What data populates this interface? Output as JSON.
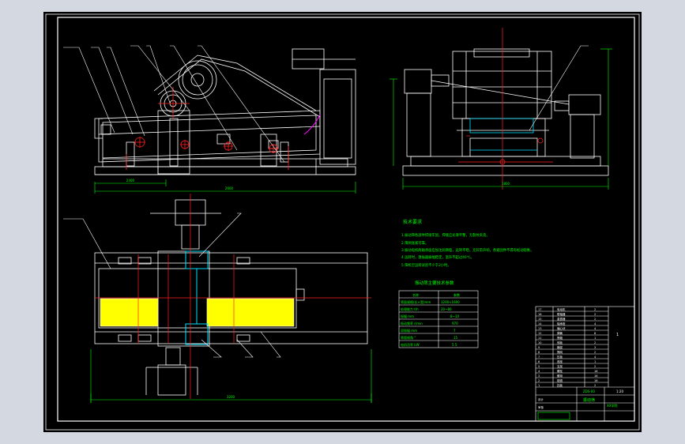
{
  "app": {
    "title": "CAD drawing viewer"
  },
  "colors": {
    "viewport_bg": "#d4d8e0",
    "sheet": "#000000",
    "border": "#ffffff",
    "geometry": "#ffffff",
    "center_line": "#ff2020",
    "dimension": "#00ff00",
    "notes_text": "#00ff00",
    "highlight": "#00e0ff",
    "screen_fill": "#ffff00",
    "spring": "#ff00ff",
    "leader": "#ffffff"
  },
  "icons": {
    "title_block_logo": "company-logo-icon"
  },
  "views": {
    "front": {
      "overall_dimension": "2600",
      "base_dimension": "2400"
    },
    "side": {
      "width_dimension": "1800"
    },
    "top": {
      "length_dimension": "3200",
      "width_dimension": "1600"
    }
  },
  "notes": {
    "title": "技术要求",
    "items": [
      "1.振动筛各部件焊接牢固，焊缝应光滑平整，无裂纹夹渣。",
      "2.筛网张紧可靠。",
      "3.振动电机两轴承座应加注润滑脂，运转平稳，无异常声响，各紧固件不得有松动现象。",
      "4.运转时，激振器振幅稳定，温升不超过40℃。",
      "5.筛机空运转试验不少于2小时。"
    ]
  },
  "params_table": {
    "title": "振动筛主要技术参数",
    "headers": [
      "名称",
      "参数"
    ],
    "rows": [
      [
        "筛面规格(长×宽)mm",
        "3200×1600"
      ],
      [
        "处理能力 t/h",
        "20~80"
      ],
      [
        "振幅 mm",
        "8~10"
      ],
      [
        "振动频率 r/min",
        "970"
      ],
      [
        "双振幅 mm",
        "7"
      ],
      [
        "筛面倾角 °",
        "15"
      ],
      [
        "电机功率 kW",
        "5.5"
      ]
    ]
  },
  "title_block": {
    "drawing_name": "振动筛",
    "drawing_no": "ZDS-00",
    "scale": "1:20",
    "sheet": "1",
    "label_design": "设计",
    "label_check": "审核",
    "school": "XX学院",
    "part_rows": [
      [
        "17",
        "电动机",
        "2"
      ],
      [
        "16",
        "联轴器",
        "2"
      ],
      [
        "15",
        "激振器",
        "2"
      ],
      [
        "14",
        "轴承座",
        "4"
      ],
      [
        "13",
        "偏心块",
        "4"
      ],
      [
        "12",
        "弹簧",
        "8"
      ],
      [
        "11",
        "筛箱",
        "1"
      ],
      [
        "10",
        "侧板",
        "2"
      ],
      [
        "9",
        "横梁",
        "3"
      ],
      [
        "8",
        "筛网",
        "2"
      ],
      [
        "7",
        "压板",
        "4"
      ],
      [
        "6",
        "底座",
        "1"
      ],
      [
        "5",
        "支架",
        "2"
      ],
      [
        "4",
        "螺栓",
        "16"
      ],
      [
        "3",
        "螺母",
        "16"
      ],
      [
        "2",
        "垫圈",
        "16"
      ],
      [
        "1",
        "挡板",
        "2"
      ]
    ]
  }
}
